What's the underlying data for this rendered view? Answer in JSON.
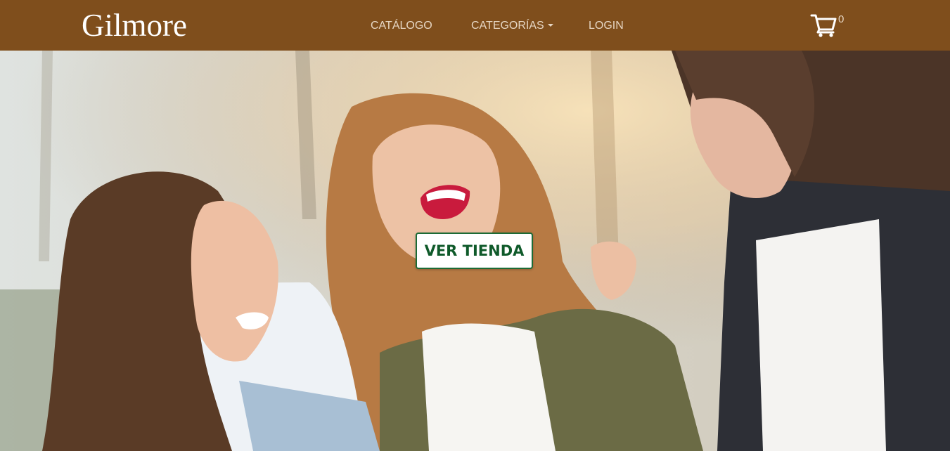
{
  "navbar": {
    "brand": "Gilmore",
    "links": [
      {
        "label": "CATÁLOGO"
      },
      {
        "label": "CATEGORÍAS",
        "has_dropdown": true
      },
      {
        "label": "LOGIN"
      }
    ],
    "cart": {
      "icon": "shopping-cart-icon",
      "count": "0"
    },
    "colors": {
      "background": "#7f4e1c",
      "link_text": "#e6d6c3",
      "brand_text": "#ffffff"
    }
  },
  "hero": {
    "image": "hero-photo-three-women-laughing",
    "cta_label": "VER TIENDA",
    "colors": {
      "cta_text": "#0f5a2a",
      "cta_border": "#1c6b36"
    }
  }
}
